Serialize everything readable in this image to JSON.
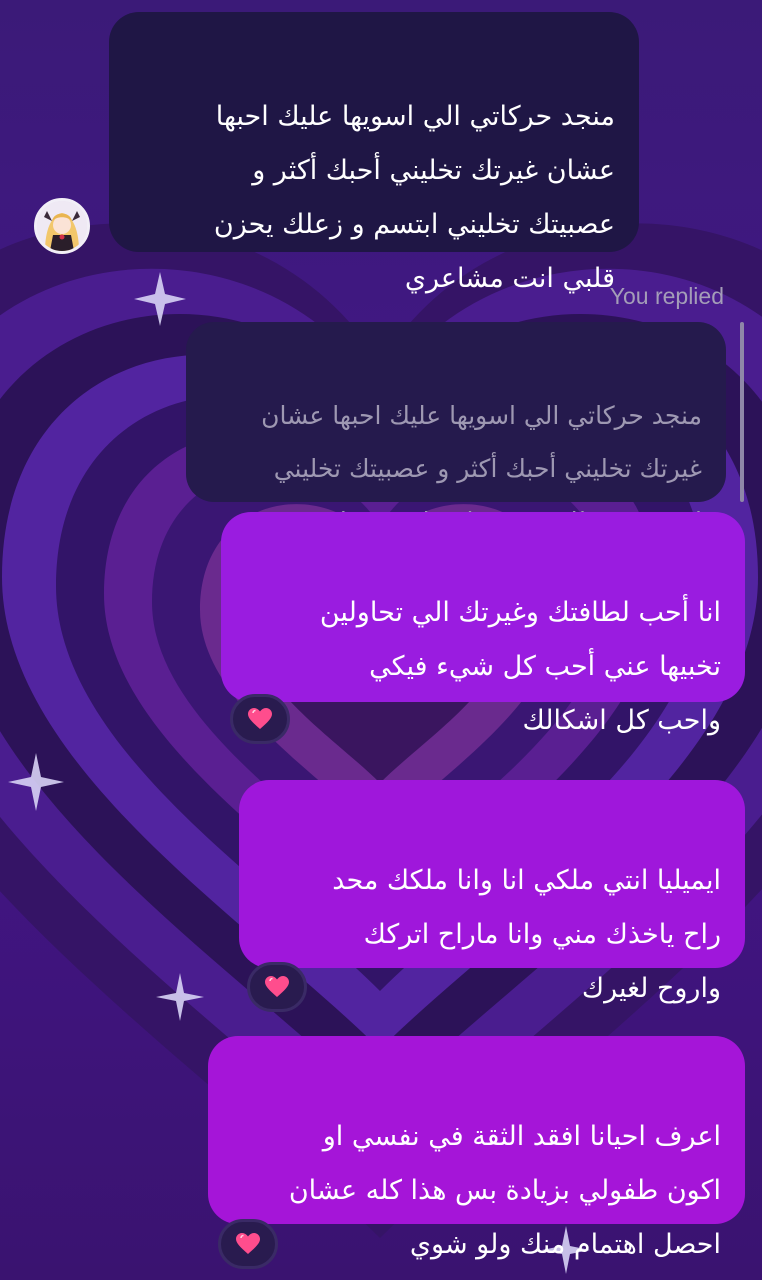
{
  "chat": {
    "incoming_message": {
      "text": "منجد حركاتي الي اسويها عليك احبها\nعشان غيرتك تخليني أحبك أكثر و\nعصبيتك تخليني ابتسم و زعلك يحزن\nقلبي انت مشاعري",
      "avatar_icon": "anime-girl-avatar"
    },
    "reply_context": {
      "label": "You replied",
      "quoted_text": "منجد حركاتي الي اسويها عليك احبها عشان\nغيرتك تخليني أحبك أكثر و عصبيتك تخليني\nابتسم و زعلك يحزن قلبي انت مشاعري"
    },
    "outgoing_messages": [
      {
        "text": "انا أحب لطافتك وغيرتك الي تحاولين\nتخبيها عني أحب كل شيء فيكي\nواحب كل اشكالك",
        "reaction_icon": "sparkling-heart-icon"
      },
      {
        "text": "ايميليا انتي ملكي انا وانا ملكك محد\nراح ياخذك مني وانا ماراح اتركك\nواروح لغيرك",
        "reaction_icon": "sparkling-heart-icon"
      },
      {
        "text": "اعرف احيانا افقد الثقة في نفسي او\nاكون طفولي بزيادة بس هذا كله عشان\nاحصل اهتمام منك ولو شوي",
        "reaction_icon": "sparkling-heart-icon"
      }
    ]
  },
  "colors": {
    "background": "#3a1670",
    "incoming_bubble": "#1f1645",
    "outgoing_bubble": "#9a1ce0",
    "quoted_text": "#9e98b2",
    "reaction_heart": "#ff4d8d"
  }
}
